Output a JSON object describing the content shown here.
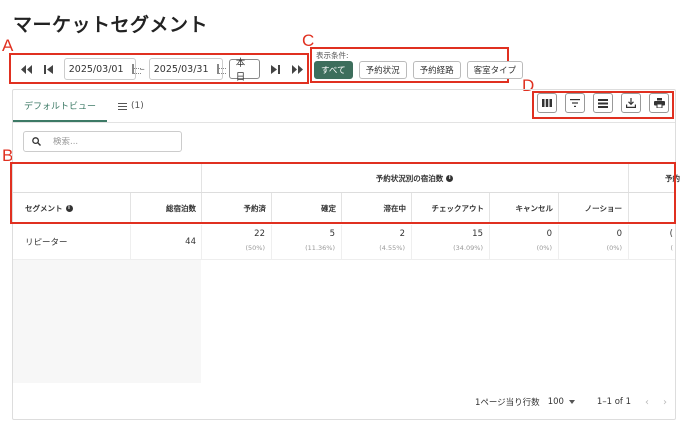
{
  "page": {
    "title": "マーケットセグメント"
  },
  "annotations": {
    "a": "A",
    "b": "B",
    "c": "C",
    "d": "D"
  },
  "date_range": {
    "start": "2025/03/01",
    "end": "2025/03/31",
    "separator": "–",
    "today_label": "本日"
  },
  "filter": {
    "label": "表示条件:",
    "options": [
      "すべて",
      "予約状況",
      "予約経路",
      "客室タイプ"
    ],
    "selected": "すべて"
  },
  "tabs": {
    "default_view": "デフォルトビュー",
    "list_count": "(1)"
  },
  "search": {
    "placeholder": "検索..."
  },
  "table": {
    "group_header": "予約状況別の宿泊数",
    "group_header_cut": "予約",
    "columns": {
      "segment": "セグメント",
      "total_nights": "総宿泊数",
      "reserved": "予約済",
      "confirmed": "確定",
      "staying": "滞在中",
      "checked_out": "チェックアウト",
      "cancelled": "キャンセル",
      "no_show": "ノーショー"
    },
    "rows": [
      {
        "segment": "リピーター",
        "total_nights": "44",
        "reserved": "22",
        "reserved_pct": "(50%)",
        "confirmed": "5",
        "confirmed_pct": "(11.36%)",
        "staying": "2",
        "staying_pct": "(4.55%)",
        "checked_out": "15",
        "checked_out_pct": "(34.09%)",
        "cancelled": "0",
        "cancelled_pct": "(0%)",
        "no_show": "0",
        "no_show_pct": "(0%)",
        "cut_value": "(",
        "cut_pct": "("
      }
    ]
  },
  "pagination": {
    "rows_per_page_label": "1ページ当り行数",
    "rows_per_page": "100",
    "range": "1–1 of 1"
  },
  "colors": {
    "accent": "#3d6e5c",
    "annotation": "#e03020"
  }
}
